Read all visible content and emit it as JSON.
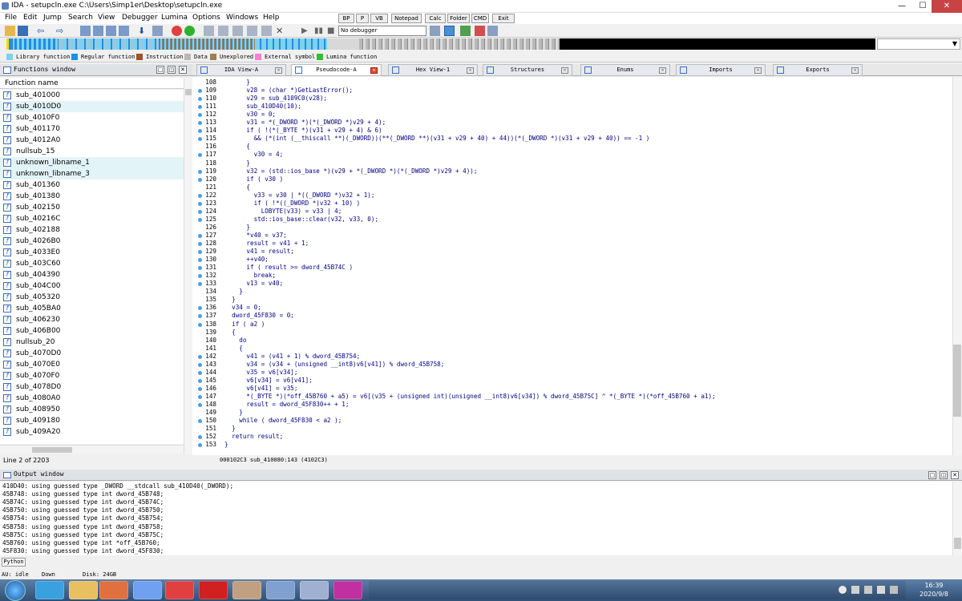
{
  "window": {
    "title": "IDA - setupcln.exe C:\\Users\\Simp1er\\Desktop\\setupcln.exe",
    "controls": {
      "minimize": "—",
      "maximize": "☐",
      "close": "✕"
    }
  },
  "menu": [
    "File",
    "Edit",
    "Jump",
    "Search",
    "View",
    "Debugger",
    "Lumina",
    "Options",
    "Windows",
    "Help"
  ],
  "plugin_buttons": [
    "BP",
    "P",
    "VB",
    "Notepad",
    "Calc",
    "Folder",
    "CMD",
    "Exit"
  ],
  "toolbar": {
    "debugger_select": "No debugger"
  },
  "legend": [
    {
      "label": "Library function",
      "color": "#7fd0f0"
    },
    {
      "label": "Regular function",
      "color": "#1e90e0"
    },
    {
      "label": "Instruction",
      "color": "#a0522d"
    },
    {
      "label": "Data",
      "color": "#b8b8b8"
    },
    {
      "label": "Unexplored",
      "color": "#a08050"
    },
    {
      "label": "External symbol",
      "color": "#ff80d0"
    },
    {
      "label": "Lumina function",
      "color": "#30c030"
    }
  ],
  "functions_window": {
    "title": "Functions window",
    "column": "Function name",
    "items": [
      "sub_401000",
      "sub_4010D0",
      "sub_4010F0",
      "sub_401170",
      "sub_4012A0",
      "nullsub_15",
      "unknown_libname_1",
      "unknown_libname_3",
      "sub_401360",
      "sub_401380",
      "sub_402150",
      "sub_40216C",
      "sub_402188",
      "sub_4026B0",
      "sub_4033E0",
      "sub_403C60",
      "sub_404390",
      "sub_404C00",
      "sub_405320",
      "sub_405BA0",
      "sub_406230",
      "sub_406B00",
      "nullsub_20",
      "sub_4070D0",
      "sub_4070E0",
      "sub_4070F0",
      "sub_4078D0",
      "sub_4080A0",
      "sub_408950",
      "sub_409180",
      "sub_409A20"
    ],
    "highlighted": [
      1,
      6,
      7
    ],
    "status": "Line 2 of 2203"
  },
  "tabs": [
    {
      "label": "IDA View-A",
      "active": false
    },
    {
      "label": "Pseudocode-A",
      "active": true
    },
    {
      "label": "Hex View-1",
      "active": false
    },
    {
      "label": "Structures",
      "active": false
    },
    {
      "label": "Enums",
      "active": false
    },
    {
      "label": "Imports",
      "active": false
    },
    {
      "label": "Exports",
      "active": false
    }
  ],
  "code": {
    "lines": [
      {
        "n": "108",
        "dot": false,
        "t": "      }"
      },
      {
        "n": "109",
        "dot": true,
        "t": "      v28 = (char *)GetLastError();"
      },
      {
        "n": "110",
        "dot": true,
        "t": "      v29 = sub_4109C0(v28);"
      },
      {
        "n": "111",
        "dot": true,
        "t": "      sub_410D40(10);"
      },
      {
        "n": "112",
        "dot": true,
        "t": "      v30 = 0;"
      },
      {
        "n": "113",
        "dot": true,
        "t": "      v31 = *(_DWORD *)(*(_DWORD *)v29 + 4);"
      },
      {
        "n": "114",
        "dot": true,
        "t": "      if ( !(*(_BYTE *)(v31 + v29 + 4) & 6)"
      },
      {
        "n": "115",
        "dot": true,
        "t": "        && (*(int (__thiscall **)(_DWORD))(**(_DWORD **)(v31 + v29 + 40) + 44))(*(_DWORD *)(v31 + v29 + 40)) == -1 )"
      },
      {
        "n": "116",
        "dot": false,
        "t": "      {"
      },
      {
        "n": "117",
        "dot": true,
        "t": "        v30 = 4;"
      },
      {
        "n": "118",
        "dot": false,
        "t": "      }"
      },
      {
        "n": "119",
        "dot": true,
        "t": "      v32 = (std::ios_base *)(v29 + *(_DWORD *)(*(_DWORD *)v29 + 4));"
      },
      {
        "n": "120",
        "dot": true,
        "t": "      if ( v30 )"
      },
      {
        "n": "121",
        "dot": false,
        "t": "      {"
      },
      {
        "n": "122",
        "dot": true,
        "t": "        v33 = v30 | *((_DWORD *)v32 + 1);"
      },
      {
        "n": "123",
        "dot": true,
        "t": "        if ( !*((_DWORD *)v32 + 10) )"
      },
      {
        "n": "124",
        "dot": true,
        "t": "          LOBYTE(v33) = v33 | 4;"
      },
      {
        "n": "125",
        "dot": true,
        "t": "        std::ios_base::clear(v32, v33, 0);"
      },
      {
        "n": "126",
        "dot": false,
        "t": "      }"
      },
      {
        "n": "127",
        "dot": true,
        "t": "      *v40 = v37;"
      },
      {
        "n": "128",
        "dot": true,
        "t": "      result = v41 + 1;"
      },
      {
        "n": "129",
        "dot": true,
        "t": "      v41 = result;"
      },
      {
        "n": "130",
        "dot": true,
        "t": "      ++v40;"
      },
      {
        "n": "131",
        "dot": true,
        "t": "      if ( result >= dword_45B74C )"
      },
      {
        "n": "132",
        "dot": true,
        "t": "        break;"
      },
      {
        "n": "133",
        "dot": true,
        "t": "      v13 = v40;"
      },
      {
        "n": "134",
        "dot": false,
        "t": "    }"
      },
      {
        "n": "135",
        "dot": false,
        "t": "  }"
      },
      {
        "n": "136",
        "dot": true,
        "t": "  v34 = 0;"
      },
      {
        "n": "137",
        "dot": true,
        "t": "  dword_45F830 = 0;"
      },
      {
        "n": "138",
        "dot": true,
        "t": "  if ( a2 )"
      },
      {
        "n": "139",
        "dot": false,
        "t": "  {"
      },
      {
        "n": "140",
        "dot": false,
        "t": "    do"
      },
      {
        "n": "141",
        "dot": false,
        "t": "    {"
      },
      {
        "n": "142",
        "dot": true,
        "t": "      v41 = (v41 + 1) % dword_45B754;"
      },
      {
        "n": "143",
        "dot": true,
        "t": "      v34 = (v34 + (unsigned __int8)v6[v41]) % dword_45B758;"
      },
      {
        "n": "144",
        "dot": true,
        "t": "      v35 = v6[v34];"
      },
      {
        "n": "145",
        "dot": true,
        "t": "      v6[v34] = v6[v41];"
      },
      {
        "n": "146",
        "dot": true,
        "t": "      v6[v41] = v35;"
      },
      {
        "n": "147",
        "dot": true,
        "t": "      *(_BYTE *)(*off_45B760 + a5) = v6[(v35 + (unsigned int)(unsigned __int8)v6[v34]) % dword_45B75C] ^ *(_BYTE *)(*off_45B760 + a1);"
      },
      {
        "n": "148",
        "dot": true,
        "t": "      result = dword_45F830++ + 1;"
      },
      {
        "n": "149",
        "dot": false,
        "t": "    }"
      },
      {
        "n": "150",
        "dot": true,
        "t": "    while ( dword_45F830 < a2 );"
      },
      {
        "n": "151",
        "dot": false,
        "t": "  }"
      },
      {
        "n": "152",
        "dot": true,
        "t": "  return result;"
      },
      {
        "n": "153",
        "dot": true,
        "t": "}"
      }
    ],
    "status": "000102C3 sub_410080:143 (4102C3)"
  },
  "output_window": {
    "title": "Output window",
    "lines": [
      "410D40: using guessed type _DWORD __stdcall sub_410D40(_DWORD);",
      "45B748: using guessed type int dword_45B748;",
      "45B74C: using guessed type int dword_45B74C;",
      "45B750: using guessed type int dword_45B750;",
      "45B754: using guessed type int dword_45B754;",
      "45B758: using guessed type int dword_45B758;",
      "45B75C: using guessed type int dword_45B75C;",
      "45B760: using guessed type int *off_45B760;",
      "45F830: using guessed type int dword_45F830;"
    ],
    "python_button": "Python"
  },
  "ida_status": {
    "au": "AU:  idle",
    "dir": "Down",
    "disk": "Disk: 24GB"
  },
  "taskbar": {
    "time": "16:39",
    "date": "2020/9/8"
  }
}
